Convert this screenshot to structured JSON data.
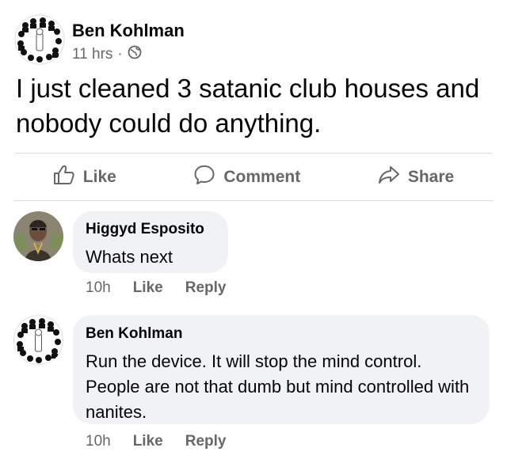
{
  "post": {
    "author": "Ben Kohlman",
    "time": "11 hrs",
    "separator": "·",
    "privacy_icon": "globe-icon",
    "text": "I just cleaned 3 satanic club houses and nobody could do anything."
  },
  "actions": {
    "like": "Like",
    "comment": "Comment",
    "share": "Share"
  },
  "comments": [
    {
      "author": "Higgyd Esposito",
      "text": "Whats next",
      "time": "10h",
      "like": "Like",
      "reply": "Reply"
    },
    {
      "author": "Ben Kohlman",
      "text": "Run the device. It will stop the mind control. People are not that dumb but mind controlled with nanites.",
      "time": "10h",
      "like": "Like",
      "reply": "Reply"
    }
  ],
  "colors": {
    "secondary_text": "#65676b",
    "bubble_bg": "#f0f2f5",
    "divider": "#dadde1"
  }
}
